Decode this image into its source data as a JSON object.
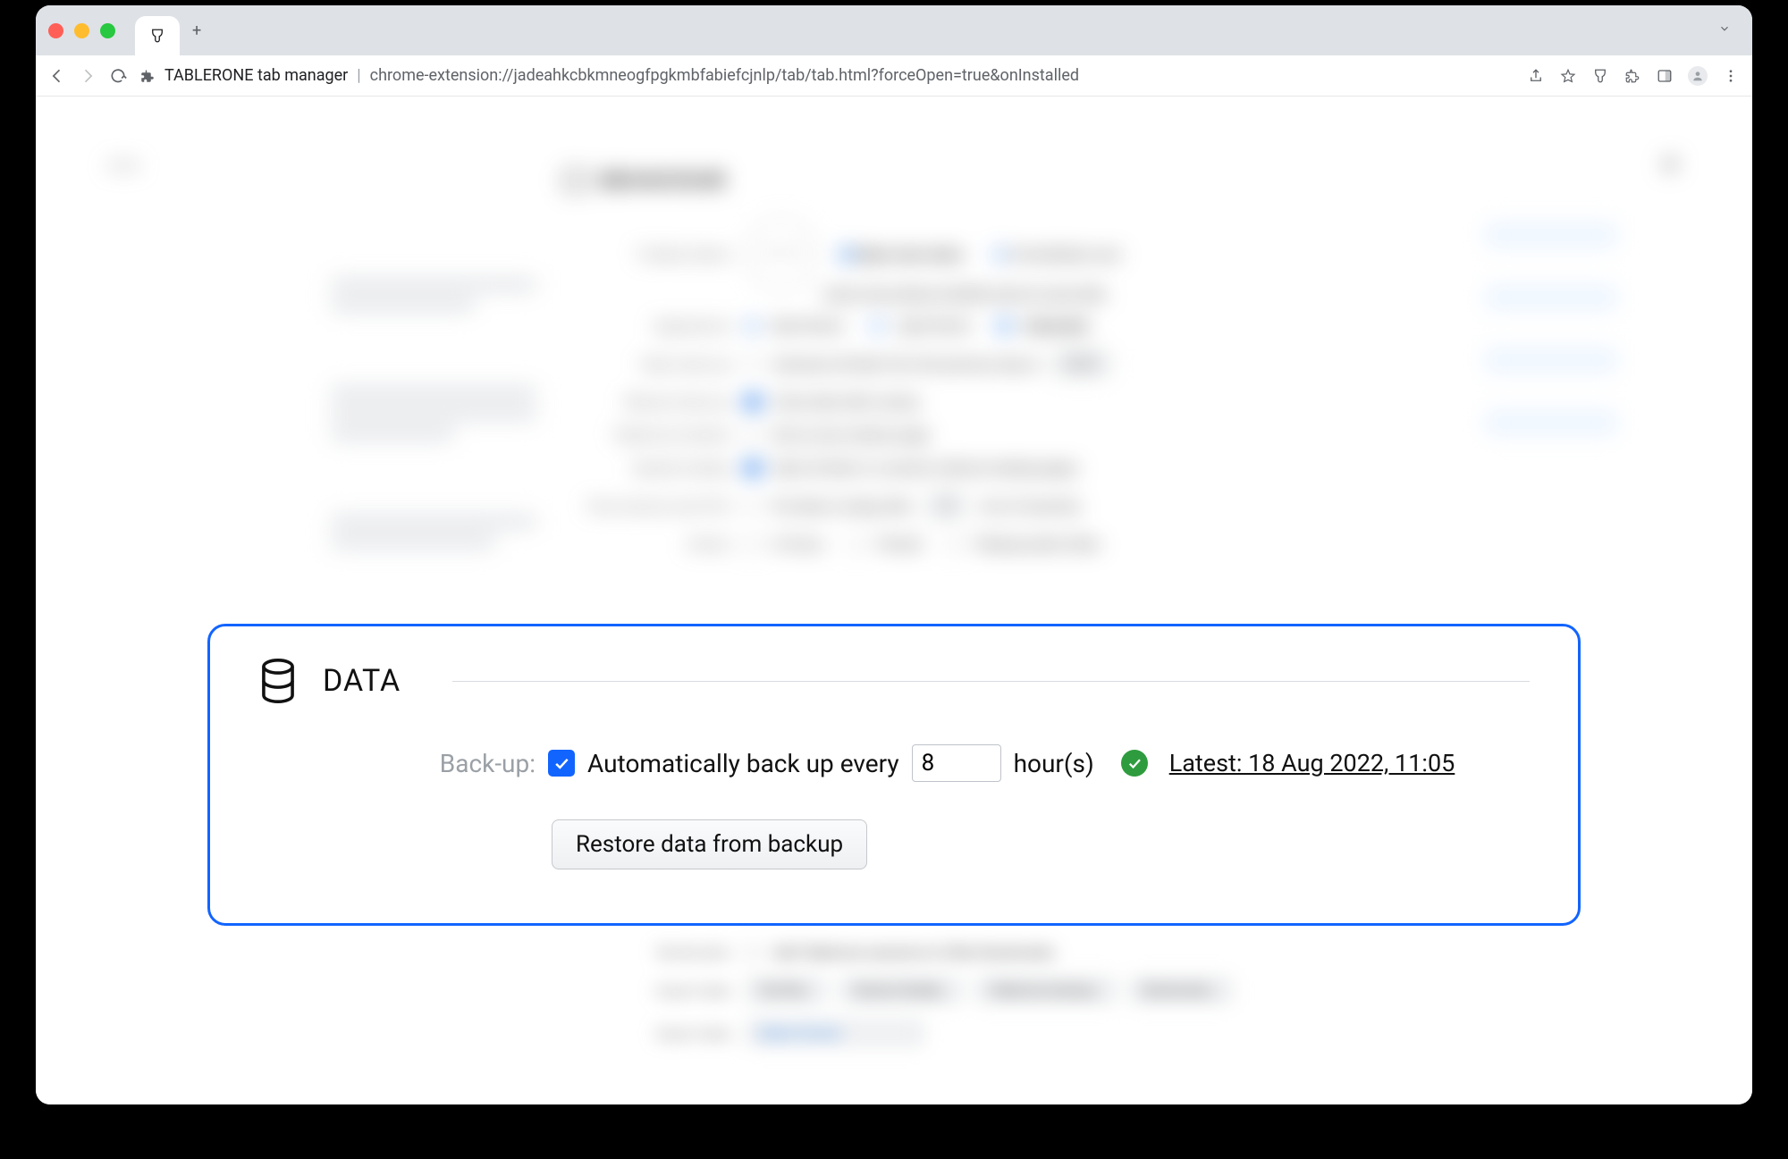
{
  "browser": {
    "page_title": "TABLERONE tab manager",
    "url": "chrome-extension://jadeahkcbkmneogfpgkmbfabiefcjnlp/tab/tab.html?forceOpen=true&onInstalled"
  },
  "blurred": {
    "version": "v13.3",
    "section_title": "BEHAVIOUR",
    "toolbar_button": {
      "label": "Toolbar button:",
      "opt1": "Open save menu",
      "opt2": "Immediately save",
      "learn": "Learn more about multiple ways to save tabs"
    },
    "appearance": {
      "label": "Appearance:",
      "opt1": "Dark theme",
      "opt2": "Light theme",
      "opt3": "Automatic"
    },
    "daily": {
      "label": "Daily clean-up:",
      "text": "Autosave all tabs from the previous day at",
      "time": "08:00"
    },
    "manual": {
      "label": "Manual clean-up:",
      "text": "Close tabs after saving"
    },
    "timeline": {
      "label": "Tablerone timeline:",
      "text": "Set as new window page"
    },
    "speedy": {
      "label": "Speedy loading:",
      "text": "Open all tabs in a session without loading pages"
    },
    "memory": {
      "label": "Free memory and CPU:",
      "text": "Put tabs to sleep after",
      "num": "30",
      "tail": "min of inactivity"
    },
    "unless": {
      "label": "Unless:",
      "opt1": "In focus",
      "opt2": "Pinned",
      "opt3": "Playing audio/video"
    },
    "below": {
      "bookmarks": {
        "label": "Bookmarks:",
        "text": "Add Tablerone sessions to Other Bookmarks"
      },
      "import_lbl": "Import data:",
      "import": [
        "OneTab…",
        "Session Buddy…",
        "Tablerone backup…",
        "Bookmarks…"
      ],
      "export": {
        "label": "Export data:",
        "select": "Select format"
      }
    }
  },
  "data_panel": {
    "title": "DATA",
    "backup_label": "Back-up:",
    "auto_text_before": "Automatically back up every",
    "auto_hours": "8",
    "auto_text_after": "hour(s)",
    "latest": "Latest: 18 Aug 2022, 11:05",
    "restore_btn": "Restore data from backup"
  }
}
